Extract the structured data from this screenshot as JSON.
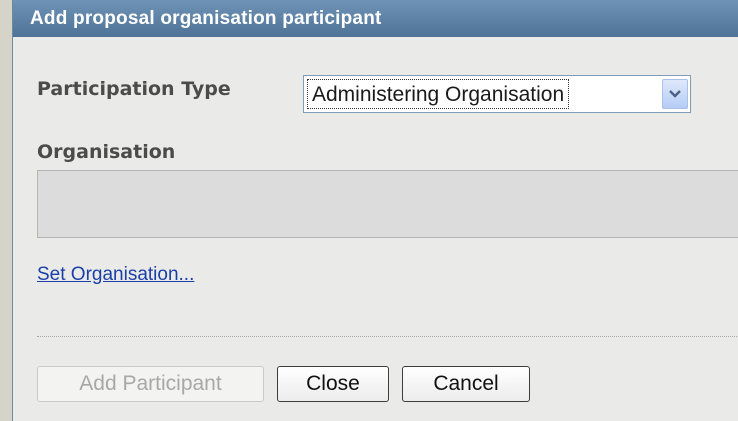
{
  "dialog": {
    "title": "Add proposal organisation participant",
    "participation_type_label": "Participation Type",
    "participation_type_value": "Administering Organisation",
    "organisation_label": "Organisation",
    "organisation_value": "",
    "set_organisation_link": "Set Organisation...",
    "buttons": {
      "add_participant": "Add Participant",
      "close": "Close",
      "cancel": "Cancel"
    },
    "add_participant_enabled": false
  },
  "icons": {
    "select_arrow": "chevron-down-icon"
  },
  "colors": {
    "title_bar": "#5b7fa3",
    "link": "#1a3fa8",
    "label": "#4b4b4b",
    "dialog_bg": "#eaebe8"
  }
}
